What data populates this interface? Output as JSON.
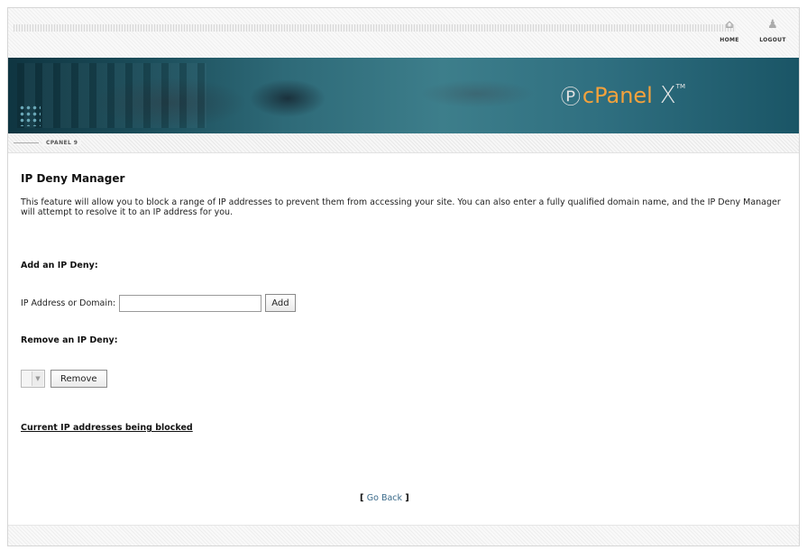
{
  "header": {
    "home_label": "HOME",
    "logout_label": "LOGOUT"
  },
  "banner": {
    "logo_text": "cPanel",
    "logo_x": "X",
    "logo_tm": "TM"
  },
  "breadcrumb": "CPANEL 9",
  "page": {
    "title": "IP Deny Manager",
    "description": "This feature will allow you to block a range of IP addresses to prevent them from accessing your site. You can also enter a fully qualified domain name, and the IP Deny Manager will attempt to resolve it to an IP address for you.",
    "add_heading": "Add an IP Deny:",
    "field_label": "IP Address or Domain:",
    "field_value": "",
    "add_button": "Add",
    "remove_heading": "Remove an IP Deny:",
    "remove_button": "Remove",
    "blocked_link": "Current IP addresses being blocked",
    "go_back_open": "[",
    "go_back_label": "Go Back",
    "go_back_close": "]"
  }
}
